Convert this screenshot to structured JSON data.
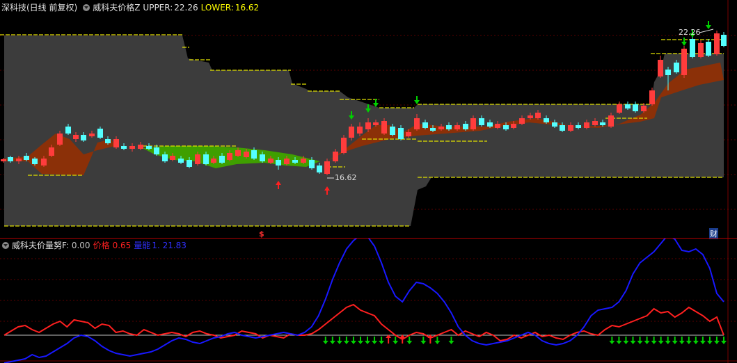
{
  "upper_panel": {
    "stock_name": "深科技(日线 前复权)",
    "indicator_name": "威科夫价格Z",
    "upper_label": "UPPER:",
    "upper_value": "22.26",
    "lower_label": "LOWER:",
    "lower_value": "16.62",
    "high_mark": "22.26",
    "low_mark": "16.62",
    "dollar_marker": "$",
    "finance_marker": "财",
    "colors": {
      "up": "#ff3c3c",
      "down": "#54ffff",
      "band": "#3c3c3c",
      "fill_bull": "#8b3008",
      "fill_bear": "#3f9f00",
      "level": "#e0e000"
    }
  },
  "lower_panel": {
    "indicator_name": "威科夫价量努F",
    "value_sep": ": 0.00",
    "price_label": "价格",
    "price_value": "0.65",
    "volume_label": "量能",
    "volume_value": "1. 21.83",
    "colors": {
      "price": "#ff2020",
      "volume": "#1818ff",
      "base": "#c0c0c0",
      "buy_arrow": "#00d000",
      "sell_arrow": "#ff2020"
    }
  },
  "chart_data": {
    "type": "line",
    "title": "威科夫价量努F",
    "x": [
      0,
      1,
      2,
      3,
      4,
      5,
      6,
      7,
      8,
      9,
      10,
      11,
      12,
      13,
      14,
      15,
      16,
      17,
      18,
      19,
      20,
      21,
      22,
      23,
      24,
      25,
      26,
      27,
      28,
      29,
      30,
      31,
      32,
      33,
      34,
      35,
      36,
      37,
      38,
      39,
      40,
      41,
      42,
      43,
      44,
      45,
      46,
      47,
      48,
      49,
      50,
      51,
      52,
      53,
      54,
      55,
      56,
      57,
      58,
      59,
      60,
      61,
      62,
      63,
      64,
      65,
      66,
      67,
      68,
      69,
      70,
      71,
      72,
      73,
      74,
      75,
      76,
      77,
      78,
      79,
      80,
      81,
      82,
      83,
      84,
      85,
      86,
      87,
      88,
      89,
      90,
      91,
      92,
      93,
      94,
      95,
      96,
      97,
      98,
      99,
      100,
      101,
      102,
      103
    ],
    "series": [
      {
        "name": "价格",
        "values": [
          0,
          0.15,
          0.3,
          0.35,
          0.2,
          0.1,
          0.25,
          0.4,
          0.5,
          0.3,
          0.55,
          0.5,
          0.45,
          0.25,
          0.4,
          0.35,
          0.1,
          0.15,
          0.05,
          0.0,
          0.2,
          0.1,
          0.0,
          0.05,
          0.1,
          0.05,
          -0.05,
          0.1,
          0.15,
          0.05,
          0.0,
          -0.1,
          -0.05,
          0.0,
          0.15,
          0.1,
          0.05,
          -0.1,
          0.0,
          -0.05,
          -0.1,
          0.05,
          0.0,
          0.0,
          0.05,
          0.2,
          0.4,
          0.6,
          0.8,
          1.0,
          1.1,
          0.9,
          0.8,
          0.7,
          0.4,
          0.2,
          0.0,
          -0.15,
          0.0,
          0.1,
          0.05,
          -0.1,
          0.0,
          0.1,
          0.2,
          0.0,
          0.15,
          0.05,
          -0.05,
          0.1,
          0.0,
          -0.2,
          -0.15,
          0.0,
          -0.1,
          0.0,
          0.1,
          -0.05,
          0.0,
          -0.1,
          -0.15,
          0.0,
          0.1,
          0.15,
          0.05,
          0.0,
          0.2,
          0.35,
          0.3,
          0.4,
          0.5,
          0.6,
          0.7,
          0.95,
          0.8,
          0.85,
          0.65,
          0.8,
          1.0,
          0.85,
          0.7,
          0.5,
          0.65,
          0.0
        ]
      },
      {
        "name": "量能",
        "values": [
          -1.0,
          -0.95,
          -0.9,
          -0.85,
          -0.7,
          -0.8,
          -0.75,
          -0.6,
          -0.45,
          -0.3,
          -0.1,
          0.0,
          -0.05,
          -0.2,
          -0.4,
          -0.55,
          -0.65,
          -0.7,
          -0.75,
          -0.7,
          -0.65,
          -0.6,
          -0.5,
          -0.35,
          -0.2,
          -0.1,
          -0.15,
          -0.25,
          -0.3,
          -0.2,
          -0.1,
          -0.05,
          0.05,
          0.1,
          0.0,
          -0.05,
          -0.1,
          -0.05,
          0.0,
          0.05,
          0.1,
          0.05,
          0.0,
          0.1,
          0.3,
          0.7,
          1.3,
          2.0,
          2.6,
          3.1,
          3.4,
          3.6,
          3.55,
          3.2,
          2.6,
          1.9,
          1.4,
          1.2,
          1.6,
          1.9,
          1.85,
          1.7,
          1.5,
          1.2,
          0.8,
          0.3,
          0.0,
          -0.2,
          -0.3,
          -0.35,
          -0.3,
          -0.25,
          -0.2,
          -0.1,
          0.0,
          0.1,
          0.0,
          -0.2,
          -0.3,
          -0.35,
          -0.3,
          -0.2,
          0.0,
          0.3,
          0.7,
          0.9,
          0.95,
          1.0,
          1.2,
          1.6,
          2.2,
          2.6,
          2.8,
          3.0,
          3.3,
          3.6,
          3.45,
          3.05,
          3.0,
          3.1,
          2.9,
          2.4,
          1.5,
          1.2
        ]
      }
    ],
    "buy_signals": [
      46,
      47,
      48,
      49,
      50,
      51,
      52,
      53,
      54,
      56,
      58,
      60,
      62,
      64,
      87,
      88,
      89,
      90,
      91,
      92,
      93,
      94,
      95,
      96,
      97,
      98,
      99,
      100,
      101,
      102,
      103
    ],
    "sell_signals": [
      55,
      57,
      61
    ]
  }
}
